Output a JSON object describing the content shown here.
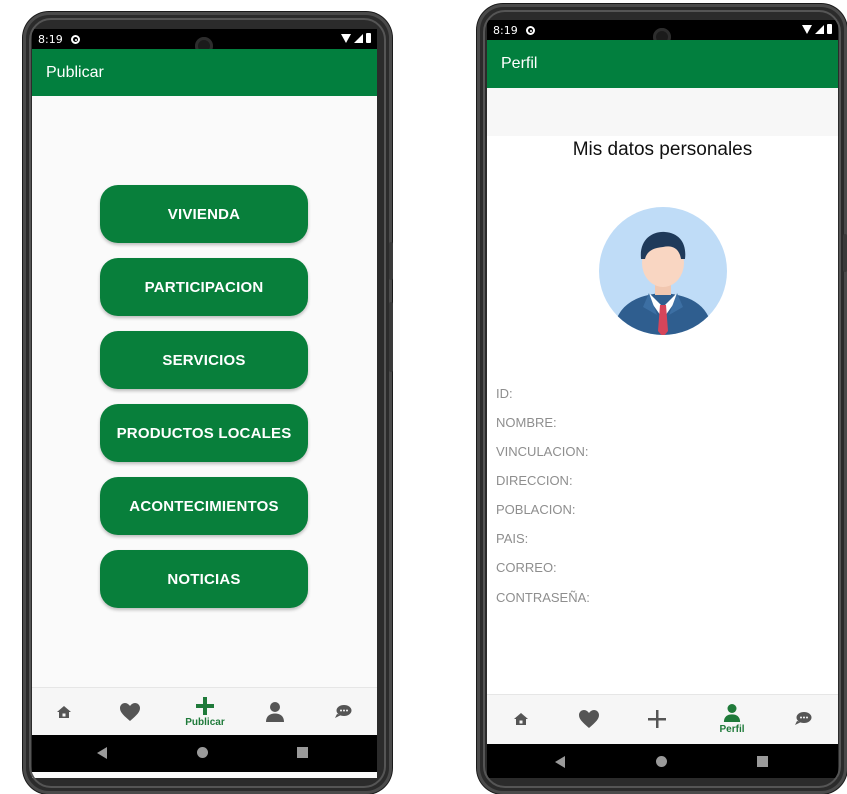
{
  "left": {
    "status_time": "8:19",
    "title": "Publicar",
    "menu": [
      {
        "label": "VIVIENDA"
      },
      {
        "label": "PARTICIPACION"
      },
      {
        "label": "SERVICIOS"
      },
      {
        "label": "PRODUCTOS LOCALES"
      },
      {
        "label": "ACONTECIMIENTOS"
      },
      {
        "label": "NOTICIAS"
      }
    ],
    "bottom_nav": {
      "items": [
        "home-icon",
        "heart-icon",
        "add-icon",
        "person-icon",
        "chat-icon"
      ],
      "active_label": "Publicar"
    }
  },
  "right": {
    "status_time": "8:19",
    "title": "Perfil",
    "heading": "Mis datos personales",
    "fields": [
      {
        "label": "ID:"
      },
      {
        "label": "NOMBRE:"
      },
      {
        "label": "VINCULACION:"
      },
      {
        "label": "DIRECCION:"
      },
      {
        "label": "POBLACION:"
      },
      {
        "label": "PAIS:"
      },
      {
        "label": "CORREO:"
      },
      {
        "label": "CONTRASEÑA:"
      }
    ],
    "bottom_nav": {
      "items": [
        "home-icon",
        "heart-icon",
        "add-icon",
        "person-icon",
        "chat-icon"
      ],
      "active_label": "Perfil"
    }
  },
  "colors": {
    "primary": "#027f3e",
    "button": "#087f3b",
    "field_text": "#8e8e8e"
  }
}
